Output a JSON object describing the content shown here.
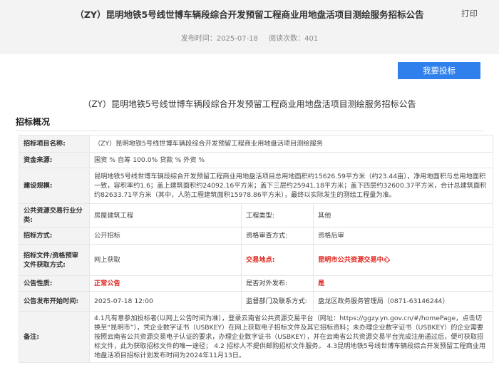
{
  "header": {
    "title": "（ZY）昆明地铁5号线世博车辆段综合开发预留工程商业用地盘活项目测绘服务招标公告",
    "print_label": "打印",
    "publish_time": "发布时间：2025-07-18",
    "views": "阅读次数：401"
  },
  "actions": {
    "bid_button": "我要投标"
  },
  "body": {
    "subtitle": "（ZY）昆明地铁5号线世博车辆段综合开发预留工程商业用地盘活项目测绘服务招标公告",
    "section_title": "招标概况"
  },
  "table": {
    "project_name_label": "招标项目名称:",
    "project_name": "（ZY）昆明地铁5号线世博车辆段综合开发预留工程商业用地盘活项目测绘服务",
    "fund_source_label": "资金来源:",
    "fund_source": "国资 % 自筹 100.0% 贷款 % 外资 %",
    "scale_label": "建设规模:",
    "scale": "昆明地铁5号线世博车辆段综合开发预留工程商业用地盘活项目总用地面积约15626.59平方米（约23.44亩），净用地面积与总用地面积一致，容积率约1.6；盖上建筑面积约24092.16平方米；盖下三层约25941.18平方米；盖下四层约32600.37平方米，合计总建筑面积约82633.71平方米（其中，人防工程建筑面积15978.86平方米），最终以实际发生的测绘工程量为准。",
    "category_label": "公共资源交易行业分类:",
    "category": "房屋建筑工程",
    "project_type_label": "工程类型:",
    "project_type": "其他",
    "tender_method_label": "招标方式:",
    "tender_method": "公开招标",
    "review_method_label": "资格审查方式:",
    "review_method": "资格后审",
    "doc_method_label": "招标文件/资格预审文件获取方式:",
    "doc_method": "网上获取",
    "venue_label": "交易地点:",
    "venue": "昆明市公共资源交易中心",
    "nature_label": "公告性质:",
    "nature": "正常公告",
    "external_label": "是否对外发布:",
    "external": "是",
    "start_time_label": "公告发布开始时间:",
    "start_time": "2025-07-18 12:00",
    "supervisor_label": "监督部门及联系方式:",
    "supervisor": "盘龙区政务服务管理局（0871-63146244）",
    "remarks_label": "备注:",
    "remarks": "4.1凡有意参加投标者(以网上公告时间为准），登录云南省公共资源交易平台（网址：https://ggzy.yn.gov.cn/#/homePage，点击切换至“昆明市”），凭企业数字证书（USBKEY）在网上获取电子招标文件及其它招标资料；未办理企业数字证书（USBKEY）的企业需要按照云南省公共资源交易电子认证的要求，办理企业数字证书（USBKEY），并在云南省公共资源交易平台完成注册通过后，便可获取招标文件，此为获取招标文件的唯一途径；  4.2 招标人不提供邮购招标文件服务。 4.3昆明地铁5号线世博车辆段综合开发预留工程商业用地盘活项目招标计划发布时间为2024年11月13日。"
  },
  "colors": {
    "accent": "#2f80ed",
    "highlight_red": "#e0261f",
    "header_bg": "#f3f3f3"
  }
}
